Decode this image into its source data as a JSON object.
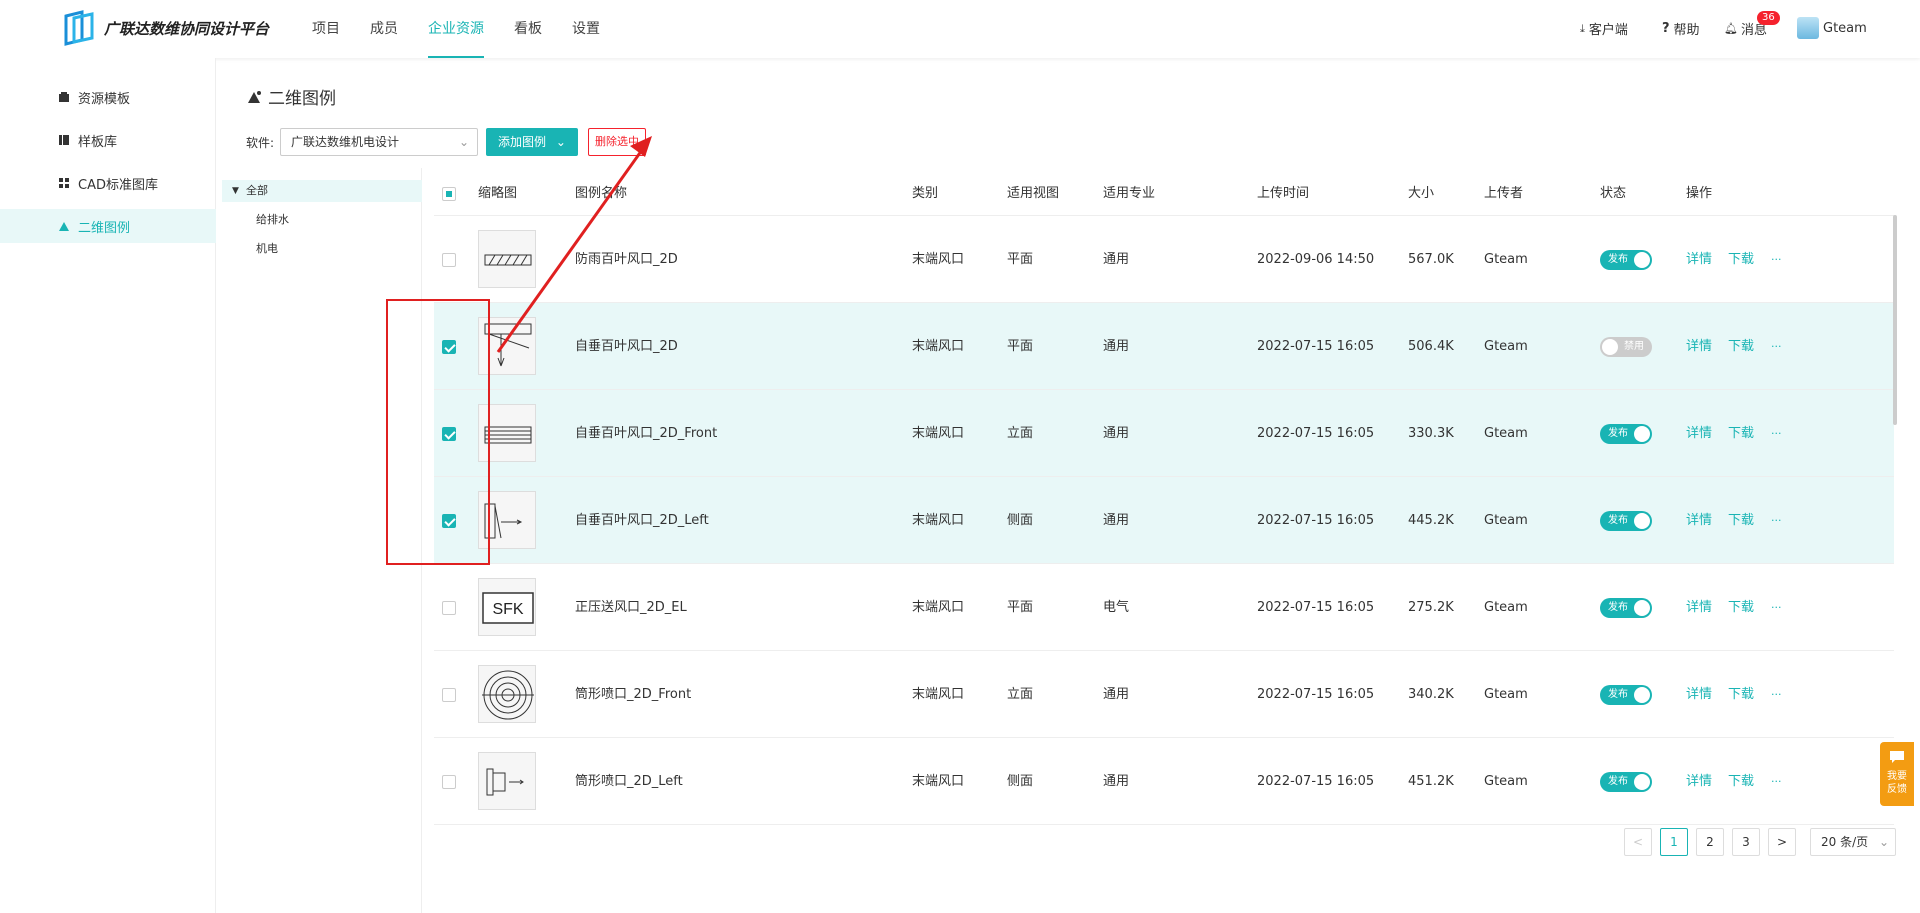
{
  "app": {
    "logo_text": "广联达数维协同设计平台"
  },
  "nav": [
    {
      "label": "项目",
      "active": false
    },
    {
      "label": "成员",
      "active": false
    },
    {
      "label": "企业资源",
      "active": true
    },
    {
      "label": "看板",
      "active": false
    },
    {
      "label": "设置",
      "active": false
    }
  ],
  "topright": {
    "client": "客户端",
    "help": "帮助",
    "messages": "消息",
    "message_count": "36",
    "user": "Gteam"
  },
  "sidebar": [
    {
      "label": "资源模板",
      "active": false,
      "icon": "box-icon"
    },
    {
      "label": "样板库",
      "active": false,
      "icon": "book-icon"
    },
    {
      "label": "CAD标准图库",
      "active": false,
      "icon": "grid-icon"
    },
    {
      "label": "二维图例",
      "active": true,
      "icon": "shapes-icon"
    }
  ],
  "main": {
    "title": "二维图例",
    "software_label": "软件:",
    "software_value": "广联达数维机电设计",
    "add_button": "添加图例",
    "delete_button": "删除选中"
  },
  "tree": {
    "root": "全部",
    "children": [
      "给排水",
      "机电"
    ]
  },
  "table": {
    "headers": [
      "缩略图",
      "图例名称",
      "类别",
      "适用视图",
      "适用专业",
      "上传时间",
      "大小",
      "上传者",
      "状态",
      "操作"
    ],
    "rows": [
      {
        "checked": false,
        "thumb": "louver-rain",
        "name": "防雨百叶风口_2D",
        "category": "末端风口",
        "view": "平面",
        "discipline": "通用",
        "time": "2022-09-06 14:50",
        "size": "567.0K",
        "uploader": "Gteam",
        "status_on": true,
        "status": "发布"
      },
      {
        "checked": true,
        "thumb": "louver-plan",
        "name": "自垂百叶风口_2D",
        "category": "末端风口",
        "view": "平面",
        "discipline": "通用",
        "time": "2022-07-15 16:05",
        "size": "506.4K",
        "uploader": "Gteam",
        "status_on": false,
        "status": "禁用"
      },
      {
        "checked": true,
        "thumb": "louver-front",
        "name": "自垂百叶风口_2D_Front",
        "category": "末端风口",
        "view": "立面",
        "discipline": "通用",
        "time": "2022-07-15 16:05",
        "size": "330.3K",
        "uploader": "Gteam",
        "status_on": true,
        "status": "发布"
      },
      {
        "checked": true,
        "thumb": "louver-left",
        "name": "自垂百叶风口_2D_Left",
        "category": "末端风口",
        "view": "侧面",
        "discipline": "通用",
        "time": "2022-07-15 16:05",
        "size": "445.2K",
        "uploader": "Gteam",
        "status_on": true,
        "status": "发布"
      },
      {
        "checked": false,
        "thumb": "sfk",
        "thumb_text": "SFK",
        "name": "正压送风口_2D_EL",
        "category": "末端风口",
        "view": "平面",
        "discipline": "电气",
        "time": "2022-07-15 16:05",
        "size": "275.2K",
        "uploader": "Gteam",
        "status_on": true,
        "status": "发布"
      },
      {
        "checked": false,
        "thumb": "nozzle-front",
        "name": "筒形喷口_2D_Front",
        "category": "末端风口",
        "view": "立面",
        "discipline": "通用",
        "time": "2022-07-15 16:05",
        "size": "340.2K",
        "uploader": "Gteam",
        "status_on": true,
        "status": "发布"
      },
      {
        "checked": false,
        "thumb": "nozzle-left",
        "name": "筒形喷口_2D_Left",
        "category": "末端风口",
        "view": "侧面",
        "discipline": "通用",
        "time": "2022-07-15 16:05",
        "size": "451.2K",
        "uploader": "Gteam",
        "status_on": true,
        "status": "发布"
      }
    ],
    "actions": {
      "detail": "详情",
      "download": "下载",
      "more": "···"
    }
  },
  "pagination": {
    "prev": "<",
    "pages": [
      "1",
      "2",
      "3"
    ],
    "current": "1",
    "next": ">",
    "page_size": "20 条/页"
  },
  "feedback": {
    "label": "我要反馈"
  },
  "colors": {
    "accent": "#19b4b4",
    "danger": "#f5222d",
    "annotation": "#e02020"
  }
}
